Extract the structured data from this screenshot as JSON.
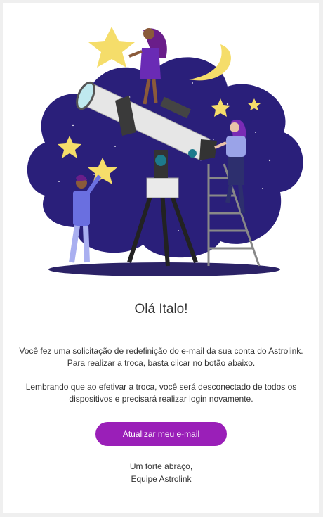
{
  "email": {
    "greeting": "Olá Italo!",
    "paragraph1": {
      "line1": "Você fez uma solicitação de redefinição do e-mail da sua conta do Astrolink.",
      "line2": "Para realizar a troca, basta clicar no botão abaixo."
    },
    "paragraph2": {
      "line1": "Lembrando que ao efetivar a troca, você será desconectado de todos os",
      "line2": "dispositivos e precisará realizar login novamente."
    },
    "cta_label": "Atualizar meu e-mail",
    "signoff": {
      "line1": "Um forte abraço,",
      "line2": "Equipe Astrolink"
    }
  },
  "colors": {
    "accent": "#9a1fb8",
    "night_sky": "#2a1f7a",
    "star": "#f5dd6a"
  },
  "illustration": {
    "subject": "people stargazing with a telescope under a night sky"
  }
}
